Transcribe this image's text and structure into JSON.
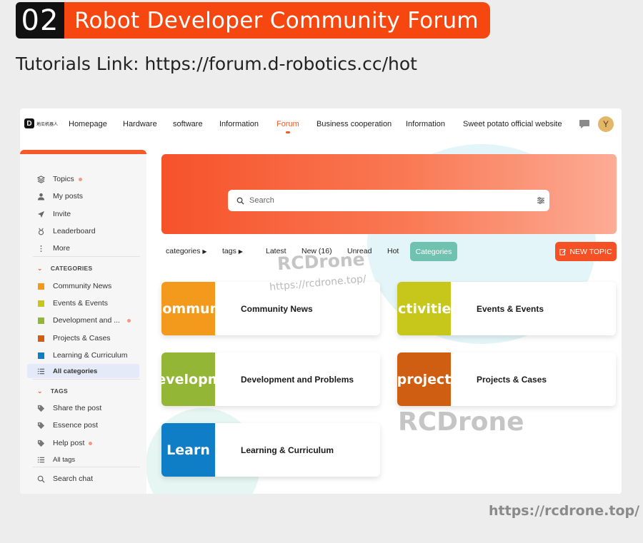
{
  "banner": {
    "number": "02",
    "title": "Robot Developer Community Forum"
  },
  "tutorials_link": "Tutorials Link: https://forum.d-robotics.cc/hot",
  "logo": {
    "mark": "D",
    "text": "地瓜机器人"
  },
  "nav": {
    "items": [
      {
        "label": "Homepage"
      },
      {
        "label": "Hardware"
      },
      {
        "label": "software"
      },
      {
        "label": "Information"
      },
      {
        "label": "Forum",
        "active": true
      },
      {
        "label": "Business cooperation"
      },
      {
        "label": "Information"
      },
      {
        "label": "Sweet potato official website"
      }
    ],
    "chat_icon": "chat-bubble-icon",
    "avatar_initial": "Y"
  },
  "sidebar": {
    "main_items": [
      {
        "label": "Topics",
        "icon": "layers-icon",
        "dot": true
      },
      {
        "label": "My posts",
        "icon": "user-icon"
      },
      {
        "label": "Invite",
        "icon": "paper-plane-icon"
      },
      {
        "label": "Leaderboard",
        "icon": "award-icon"
      },
      {
        "label": "More",
        "icon": "more-vertical-icon"
      }
    ],
    "categories_header": "CATEGORIES",
    "categories": [
      {
        "label": "Community News",
        "color": "#f39a1c"
      },
      {
        "label": "Events & Events",
        "color": "#c6c61b"
      },
      {
        "label": "Development and ...",
        "color": "#93b637",
        "dot": true
      },
      {
        "label": "Projects & Cases",
        "color": "#cf5e12"
      },
      {
        "label": "Learning & Curriculum",
        "color": "#0f7ec7"
      }
    ],
    "all_categories": "All categories",
    "tags_header": "TAGS",
    "tags": [
      {
        "label": "Share the post",
        "icon": "tag-icon"
      },
      {
        "label": "Essence post",
        "icon": "tag-icon"
      },
      {
        "label": "Help post",
        "icon": "tag-icon",
        "dot": true
      }
    ],
    "all_tags": "All tags",
    "search_chat": "Search chat"
  },
  "hero": {
    "search_placeholder": "Search"
  },
  "filters": {
    "categories": "categories",
    "tags": "tags",
    "latest": "Latest",
    "new": "New (16)",
    "unread": "Unread",
    "hot": "Hot",
    "active": "Categories"
  },
  "new_topic": "NEW TOPIC",
  "cards": [
    {
      "tile_text": "Communi",
      "label": "Community News",
      "color": "#f39a1c"
    },
    {
      "tile_text": "activities",
      "label": "Events & Events",
      "color": "#c6c61b"
    },
    {
      "tile_text": "Developme",
      "label": "Development and Problems",
      "color": "#93b637"
    },
    {
      "tile_text": "project",
      "label": "Projects & Cases",
      "color": "#cf5e12"
    },
    {
      "tile_text": "Learn",
      "label": "Learning & Curriculum",
      "color": "#0f7ec7"
    }
  ],
  "watermarks": {
    "brand": "RCDrone",
    "url": "https://rcdrone.top/",
    "brand_big": "RCDrone"
  },
  "footer_url": "https://rcdrone.top/"
}
